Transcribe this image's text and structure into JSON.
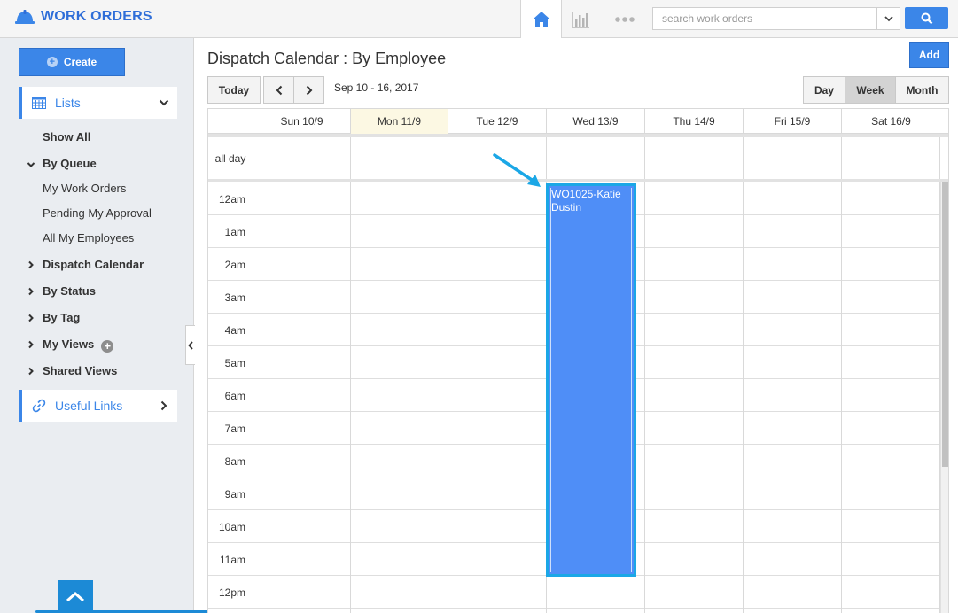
{
  "app": {
    "title": "WORK ORDERS",
    "brand_color": "#2f6ed8",
    "accent": "#3b86e8"
  },
  "header": {
    "nav": [
      {
        "name": "home-icon",
        "active": true
      },
      {
        "name": "bar-chart-icon",
        "active": false
      },
      {
        "name": "more-icon",
        "active": false
      }
    ],
    "search": {
      "placeholder": "search work orders",
      "value": ""
    }
  },
  "sidebar": {
    "create_label": "Create",
    "lists_label": "Lists",
    "items": [
      {
        "label": "Show All",
        "bold": true,
        "caret": "none"
      },
      {
        "label": "By Queue",
        "bold": true,
        "caret": "down"
      },
      {
        "label": "My Work Orders",
        "bold": false,
        "caret": "none"
      },
      {
        "label": "Pending My Approval",
        "bold": false,
        "caret": "none"
      },
      {
        "label": "All My Employees",
        "bold": false,
        "caret": "none"
      },
      {
        "label": "Dispatch Calendar",
        "bold": true,
        "caret": "right"
      },
      {
        "label": "By Status",
        "bold": true,
        "caret": "right"
      },
      {
        "label": "By Tag",
        "bold": true,
        "caret": "right"
      },
      {
        "label": "My Views",
        "bold": true,
        "caret": "right"
      },
      {
        "label": "Shared Views",
        "bold": true,
        "caret": "right"
      }
    ],
    "useful_links_label": "Useful Links"
  },
  "main": {
    "title": "Dispatch Calendar : By Employee",
    "add_label": "Add",
    "today_label": "Today",
    "date_range": "Sep 10 - 16, 2017",
    "views": {
      "day": "Day",
      "week": "Week",
      "month": "Month",
      "selected": "Week"
    },
    "days": [
      "Sun 10/9",
      "Mon 11/9",
      "Tue 12/9",
      "Wed 13/9",
      "Thu 14/9",
      "Fri 15/9",
      "Sat 16/9"
    ],
    "today_day": "Mon 11/9",
    "all_day_label": "all day",
    "hours": [
      "12am",
      "1am",
      "2am",
      "3am",
      "4am",
      "5am",
      "6am",
      "7am",
      "8am",
      "9am",
      "10am",
      "11am",
      "12pm"
    ],
    "event": {
      "title": "WO1025-Katie Dustin",
      "line1": "WO1025-Katie",
      "line2": "Dustin",
      "day": "Wed 13/9",
      "color": "#4f8ef7",
      "border_color": "#1ba7e6"
    }
  }
}
